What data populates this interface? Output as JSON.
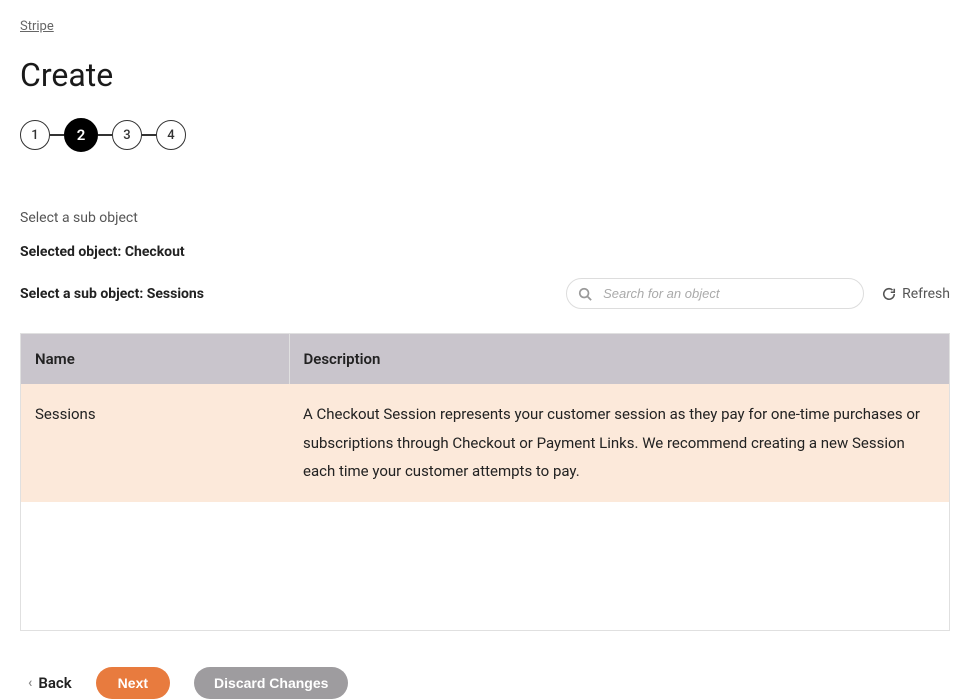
{
  "breadcrumb": "Stripe",
  "title": "Create",
  "stepper": {
    "steps": [
      "1",
      "2",
      "3",
      "4"
    ],
    "activeIndex": 1
  },
  "instruction": "Select a sub object",
  "selectedObjectLine": "Selected object: Checkout",
  "subObjectLine": "Select a sub object: Sessions",
  "search": {
    "placeholder": "Search for an object"
  },
  "refreshLabel": "Refresh",
  "table": {
    "headers": {
      "name": "Name",
      "description": "Description"
    },
    "rows": [
      {
        "name": "Sessions",
        "description": "A Checkout Session represents your customer session as they pay for one-time purchases or subscriptions through Checkout or Payment Links. We recommend creating a new Session each time your customer attempts to pay.",
        "selected": true
      }
    ]
  },
  "buttons": {
    "back": "Back",
    "next": "Next",
    "discard": "Discard Changes"
  }
}
